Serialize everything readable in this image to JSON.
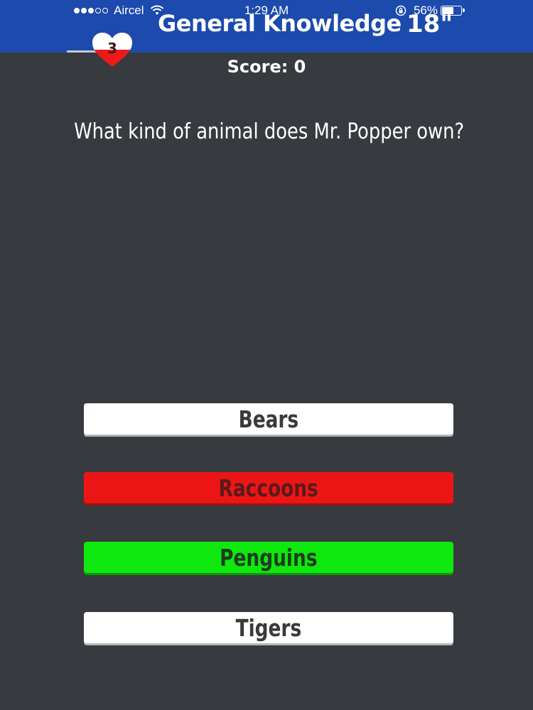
{
  "status_bar": {
    "carrier": "Aircel",
    "time": "1:29 AM",
    "battery": "56%",
    "signal_bars_filled": 3,
    "signal_bars_total": 5
  },
  "header": {
    "title": "General Knowledge",
    "timer": "18\"",
    "lives": "3",
    "background_color": "#1c4aad"
  },
  "score": {
    "label": "Score: 0"
  },
  "question": {
    "text": "What kind of animal does Mr. Popper own?"
  },
  "answers": [
    {
      "label": "Bears",
      "state": "neutral",
      "color": "#ffffff"
    },
    {
      "label": "Raccoons",
      "state": "wrong",
      "color": "#ec1515"
    },
    {
      "label": "Penguins",
      "state": "correct",
      "color": "#0ee80e"
    },
    {
      "label": "Tigers",
      "state": "neutral",
      "color": "#ffffff"
    }
  ],
  "icons": {
    "lives": "heart-icon",
    "wifi": "wifi-icon",
    "lock": "rotation-lock-icon",
    "battery": "battery-icon"
  }
}
